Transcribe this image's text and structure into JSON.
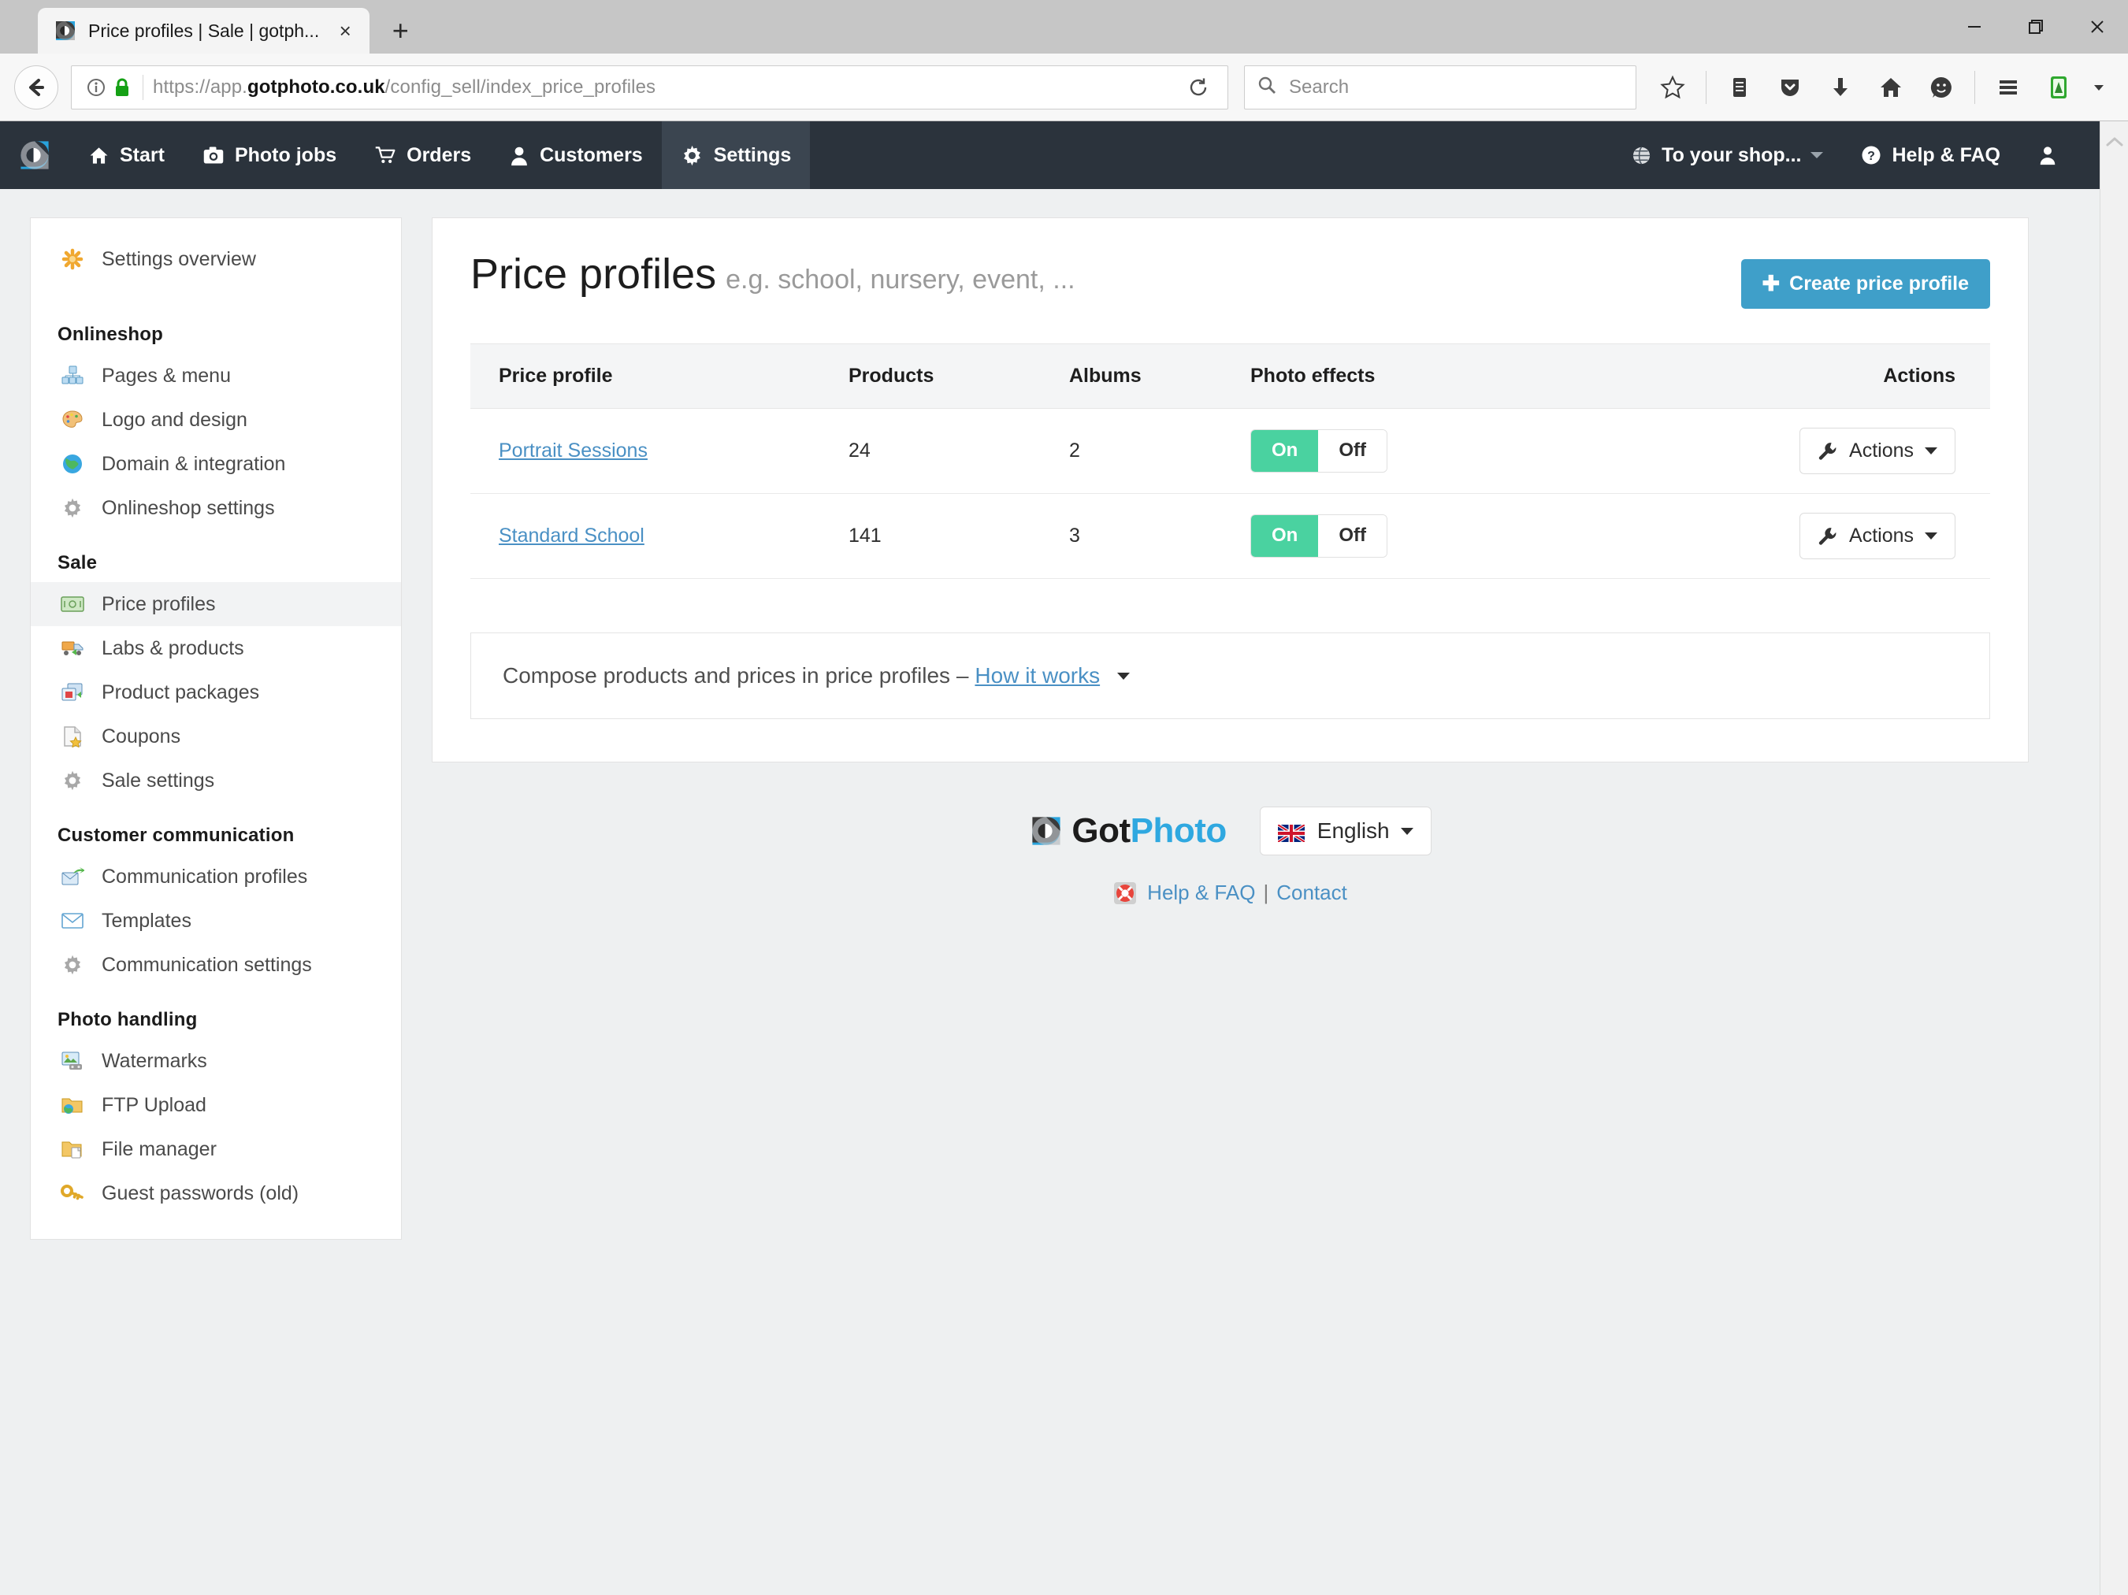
{
  "browser": {
    "tab": {
      "title": "Price profiles | Sale | gotph...",
      "favicon": "gotphoto-favicon",
      "close": "×"
    },
    "newtab_label": "+",
    "window_controls": {
      "minimize": "—",
      "maximize": "❐",
      "close": "✕"
    },
    "url": {
      "prefix": "https://app.",
      "domain": "gotphoto.co.uk",
      "path": "/config_sell/index_price_profiles"
    },
    "search_placeholder": "Search",
    "toolbar_icons": [
      "bookmark-star-icon",
      "reader-list-icon",
      "pocket-icon",
      "downloads-icon",
      "home-icon",
      "sync-face-icon",
      "hamburger-menu-icon",
      "extension-icon",
      "extension-caret-icon"
    ]
  },
  "appnav": {
    "brand": "gotphoto-logo",
    "items": [
      {
        "label": "Start",
        "icon": "home-icon",
        "active": false
      },
      {
        "label": "Photo jobs",
        "icon": "camera-icon",
        "active": false
      },
      {
        "label": "Orders",
        "icon": "cart-icon",
        "active": false
      },
      {
        "label": "Customers",
        "icon": "users-icon",
        "active": false
      },
      {
        "label": "Settings",
        "icon": "gear-icon",
        "active": true
      }
    ],
    "right": [
      {
        "label": "To your shop...",
        "icon": "globe-icon"
      },
      {
        "label": "Help & FAQ",
        "icon": "question-circle-icon"
      }
    ],
    "account_icon": "user-icon"
  },
  "sidebar": {
    "overview": {
      "label": "Settings overview",
      "icon": "asterisk-icon"
    },
    "groups": [
      {
        "heading": "Onlineshop",
        "items": [
          {
            "label": "Pages & menu",
            "icon": "pages-icon"
          },
          {
            "label": "Logo and design",
            "icon": "palette-icon"
          },
          {
            "label": "Domain & integration",
            "icon": "globe-icon"
          },
          {
            "label": "Onlineshop settings",
            "icon": "gear-icon"
          }
        ]
      },
      {
        "heading": "Sale",
        "items": [
          {
            "label": "Price profiles",
            "icon": "money-icon",
            "active": true
          },
          {
            "label": "Labs & products",
            "icon": "truck-icon"
          },
          {
            "label": "Product packages",
            "icon": "packages-icon"
          },
          {
            "label": "Coupons",
            "icon": "coupon-icon"
          },
          {
            "label": "Sale settings",
            "icon": "gear-icon"
          }
        ]
      },
      {
        "heading": "Customer communication",
        "items": [
          {
            "label": "Communication profiles",
            "icon": "mail-reply-icon"
          },
          {
            "label": "Templates",
            "icon": "envelope-icon"
          },
          {
            "label": "Communication settings",
            "icon": "gear-icon"
          }
        ]
      },
      {
        "heading": "Photo handling",
        "items": [
          {
            "label": "Watermarks",
            "icon": "watermark-icon"
          },
          {
            "label": "FTP Upload",
            "icon": "ftp-folder-icon"
          },
          {
            "label": "File manager",
            "icon": "folder-file-icon"
          },
          {
            "label": "Guest passwords (old)",
            "icon": "key-icon"
          }
        ]
      }
    ]
  },
  "main": {
    "title": "Price profiles",
    "subtitle": "e.g. school, nursery, event, ...",
    "create_button": {
      "label": "Create price profile",
      "plus": "✚"
    },
    "table": {
      "columns": [
        "Price profile",
        "Products",
        "Albums",
        "Photo effects",
        "Actions"
      ],
      "toggle": {
        "on": "On",
        "off": "Off"
      },
      "actions_label": "Actions",
      "rows": [
        {
          "profile": "Portrait Sessions",
          "products": "24",
          "albums": "2",
          "photo_effects": "On"
        },
        {
          "profile": "Standard School",
          "products": "141",
          "albums": "3",
          "photo_effects": "On"
        }
      ]
    },
    "info_box": {
      "text": "Compose products and prices in price profiles –",
      "link": "How it works"
    }
  },
  "footer": {
    "logo_got": "Got",
    "logo_photo": "Photo",
    "language": {
      "label": "English",
      "flag": "uk-flag-icon"
    },
    "help": "Help & FAQ",
    "separator": "|",
    "contact": "Contact"
  },
  "colors": {
    "navbar_bg": "#2b333c",
    "navbar_active": "#3b4550",
    "accent_blue": "#3f9fc9",
    "link_blue": "#4a90c4",
    "toggle_green": "#4ad2a0",
    "page_bg": "#eef0f1"
  }
}
